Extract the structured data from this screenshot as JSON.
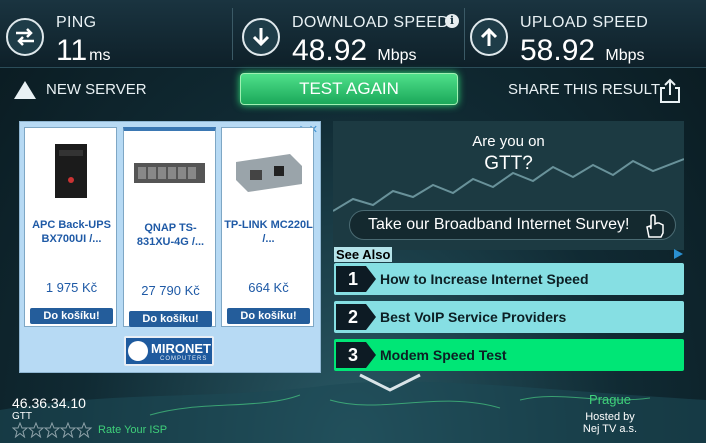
{
  "metrics": {
    "ping": {
      "label": "PING",
      "value": "11",
      "unit": "ms"
    },
    "download": {
      "label": "DOWNLOAD SPEED",
      "value": "48.92",
      "unit": "Mbps"
    },
    "upload": {
      "label": "UPLOAD SPEED",
      "value": "58.92",
      "unit": "Mbps"
    },
    "info_glyph": "i"
  },
  "actions": {
    "new_server": "NEW SERVER",
    "test_again": "TEST AGAIN",
    "share": "SHARE THIS RESULT"
  },
  "ad_left": {
    "adchoices": "▷✕",
    "products": [
      {
        "name": "APC Back-UPS BX700UI /...",
        "price": "1 975 Kč",
        "button": "Do košíku!"
      },
      {
        "name": "QNAP TS-831XU-4G /...",
        "price": "27 790 Kč",
        "button": "Do košíku!"
      },
      {
        "name": "TP-LINK MC220L /...",
        "price": "664 Kč",
        "button": "Do košíku!"
      }
    ],
    "brand": {
      "name": "MIRONET",
      "sub": "COMPUTERS"
    }
  },
  "ad_right": {
    "line1": "Are you on",
    "line2": "GTT?",
    "cta": "Take our Broadband Internet Survey!"
  },
  "see_also": {
    "title": "See Also",
    "items": [
      {
        "num": "1",
        "text": "How to Increase Internet Speed"
      },
      {
        "num": "2",
        "text": "Best VoIP Service Providers"
      },
      {
        "num": "3",
        "text": "Modem Speed Test"
      }
    ]
  },
  "footer": {
    "ip": "46.36.34.10",
    "isp": "GTT",
    "rate": "Rate Your ISP",
    "rating": 0,
    "city": "Prague",
    "hosted_by": "Hosted by",
    "host": "Nej TV a.s."
  },
  "colors": {
    "accent_green": "#2ee37a",
    "panel_dark": "#102a33"
  }
}
